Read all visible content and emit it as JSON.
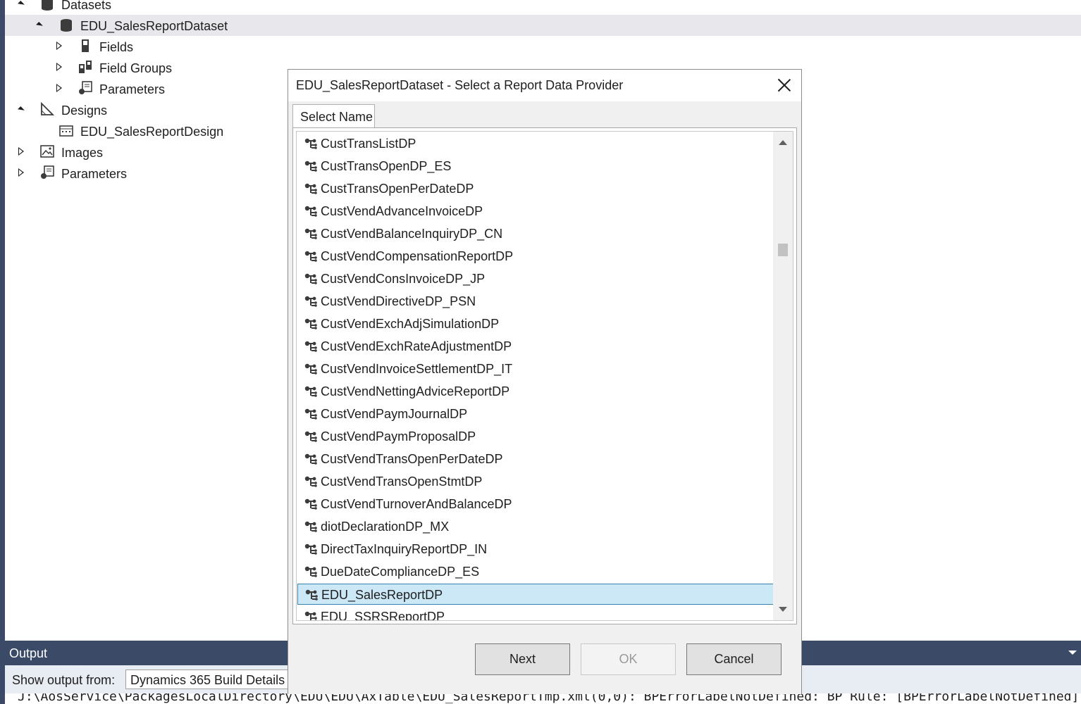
{
  "tree": {
    "items": [
      {
        "label": "Datasets",
        "icon": "database-icon",
        "expanded": true
      },
      {
        "label": "EDU_SalesReportDataset",
        "icon": "database-icon",
        "expanded": true,
        "selected": true
      },
      {
        "label": "Fields",
        "icon": "field-icon",
        "expanded": false
      },
      {
        "label": "Field Groups",
        "icon": "field-groups-icon",
        "expanded": false
      },
      {
        "label": "Parameters",
        "icon": "parameters-icon",
        "expanded": false
      },
      {
        "label": "Designs",
        "icon": "designs-icon",
        "expanded": true
      },
      {
        "label": "EDU_SalesReportDesign",
        "icon": "report-design-icon"
      },
      {
        "label": "Images",
        "icon": "image-icon",
        "expanded": false
      },
      {
        "label": "Parameters",
        "icon": "parameters-icon",
        "expanded": false
      }
    ]
  },
  "output": {
    "title": "Output",
    "show_from_label": "Show output from:",
    "source": "Dynamics 365 Build Details",
    "log_text": "J:\\AosService\\PackagesLocalDirectory\\EDU\\EDU\\AxTable\\EDU_SalesReportTmp.xml(0,0): BPErrorLabelNotDefined: BP Rule: [BPErrorLabelNotDefined]:Path: [dyn"
  },
  "dialog": {
    "title": "EDU_SalesReportDataset - Select a Report Data Provider",
    "tab_label": "Select Name",
    "items": [
      "CustTransListDP",
      "CustTransOpenDP_ES",
      "CustTransOpenPerDateDP",
      "CustVendAdvanceInvoiceDP",
      "CustVendBalanceInquiryDP_CN",
      "CustVendCompensationReportDP",
      "CustVendConsInvoiceDP_JP",
      "CustVendDirectiveDP_PSN",
      "CustVendExchAdjSimulationDP",
      "CustVendExchRateAdjustmentDP",
      "CustVendInvoiceSettlementDP_IT",
      "CustVendNettingAdviceReportDP",
      "CustVendPaymJournalDP",
      "CustVendPaymProposalDP",
      "CustVendTransOpenPerDateDP",
      "CustVendTransOpenStmtDP",
      "CustVendTurnoverAndBalanceDP",
      "diotDeclarationDP_MX",
      "DirectTaxInquiryReportDP_IN",
      "DueDateComplianceDP_ES",
      "EDU_SalesReportDP",
      "EDU_SSRSReportDP"
    ],
    "selected_item": "EDU_SalesReportDP",
    "buttons": {
      "next": "Next",
      "ok": "OK",
      "cancel": "Cancel"
    }
  }
}
